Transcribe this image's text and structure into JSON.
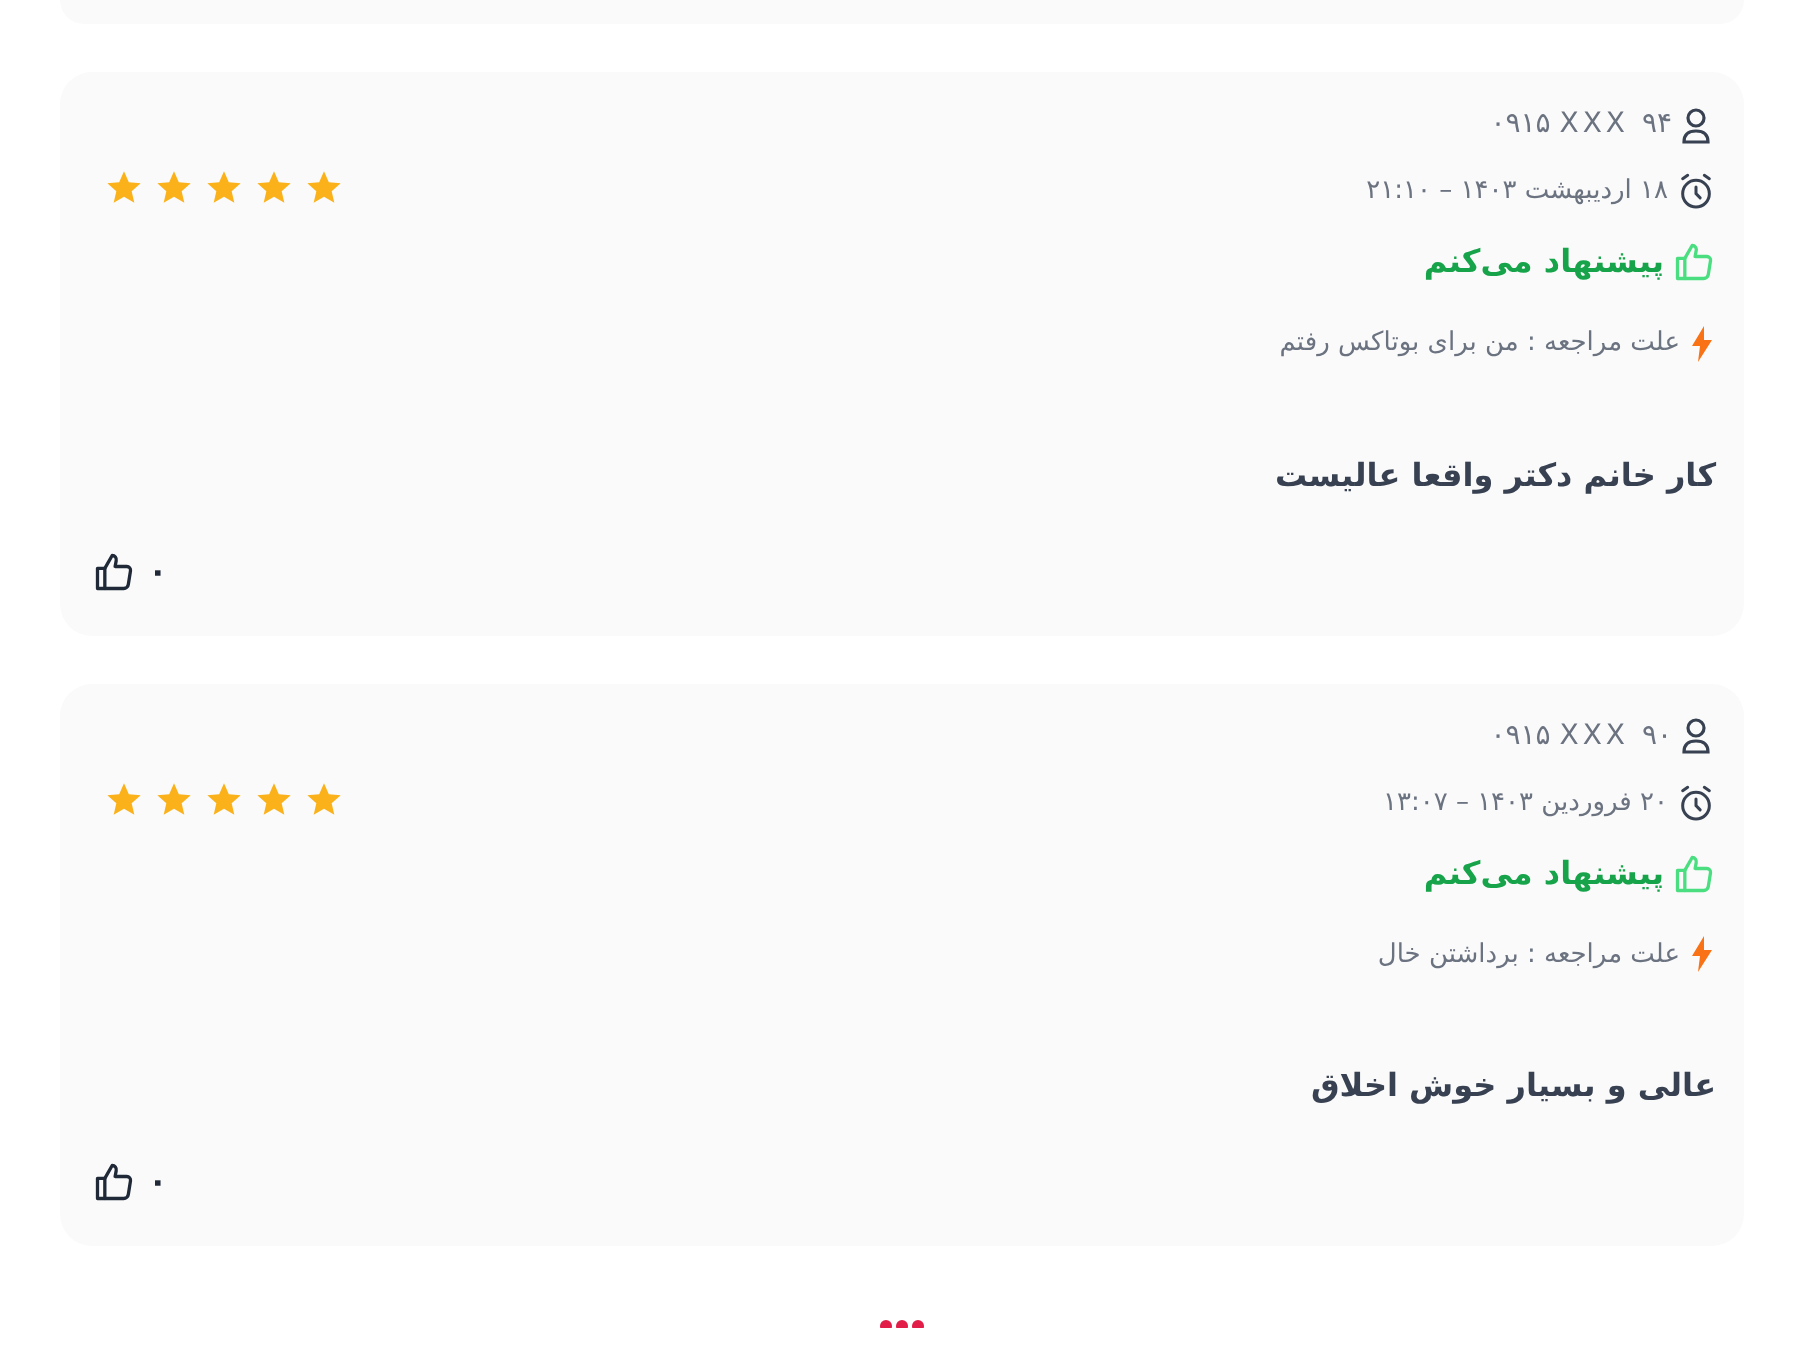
{
  "reviews": [
    {
      "phone": "۰۹۱۵ XXX ۹۴",
      "date": "۱۸ اردیبهشت ۱۴۰۳ – ۲۱:۱۰",
      "recommendation": "پیشنهاد می‌کنم",
      "recommended": true,
      "reason": "علت مراجعه : من برای بوتاکس رفتم",
      "comment": "کار خانم دکتر واقعا عالیست",
      "stars": 5,
      "likes": "۰"
    },
    {
      "phone": "۰۹۱۵ XXX ۹۰",
      "date": "۲۰ فروردین ۱۴۰۳ – ۱۳:۰۷",
      "recommendation": "پیشنهاد می‌کنم",
      "recommended": true,
      "reason": "علت مراجعه : برداشتن خال",
      "comment": "عالی و بسیار خوش اخلاق",
      "stars": 5,
      "likes": "۰"
    }
  ]
}
